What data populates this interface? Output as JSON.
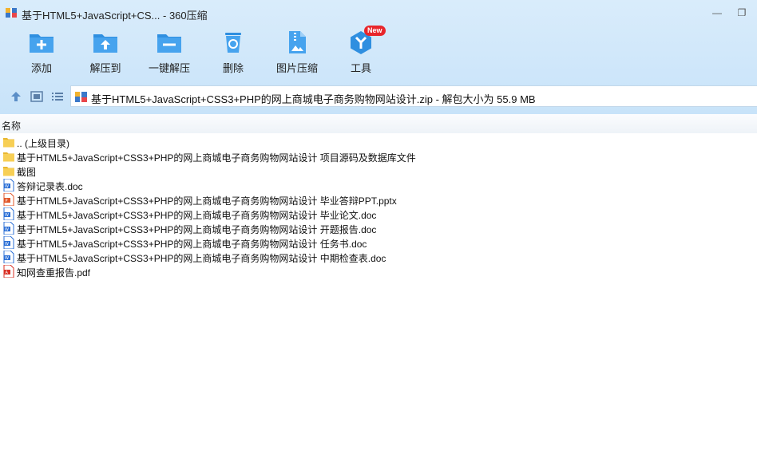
{
  "window": {
    "title": "基于HTML5+JavaScript+CS... - 360压缩",
    "minimize": "—",
    "maximize": "❐"
  },
  "toolbar": [
    {
      "label": "添加",
      "icon": "add-icon"
    },
    {
      "label": "解压到",
      "icon": "extract-to-icon"
    },
    {
      "label": "一键解压",
      "icon": "one-click-extract-icon"
    },
    {
      "label": "删除",
      "icon": "delete-icon"
    },
    {
      "label": "图片压缩",
      "icon": "image-compress-icon"
    },
    {
      "label": "工具",
      "icon": "tools-icon",
      "badge": "New"
    }
  ],
  "address": {
    "path": "基于HTML5+JavaScript+CSS3+PHP的网上商城电子商务购物网站设计.zip - 解包大小为 55.9 MB"
  },
  "columns": {
    "name": "名称"
  },
  "files": [
    {
      "name": ".. (上级目录)",
      "type": "folder"
    },
    {
      "name": "基于HTML5+JavaScript+CSS3+PHP的网上商城电子商务购物网站设计 项目源码及数据库文件",
      "type": "folder"
    },
    {
      "name": "截图",
      "type": "folder"
    },
    {
      "name": "答辩记录表.doc",
      "type": "doc"
    },
    {
      "name": "基于HTML5+JavaScript+CSS3+PHP的网上商城电子商务购物网站设计 毕业答辩PPT.pptx",
      "type": "ppt"
    },
    {
      "name": "基于HTML5+JavaScript+CSS3+PHP的网上商城电子商务购物网站设计 毕业论文.doc",
      "type": "doc"
    },
    {
      "name": "基于HTML5+JavaScript+CSS3+PHP的网上商城电子商务购物网站设计 开题报告.doc",
      "type": "doc"
    },
    {
      "name": "基于HTML5+JavaScript+CSS3+PHP的网上商城电子商务购物网站设计 任务书.doc",
      "type": "doc"
    },
    {
      "name": "基于HTML5+JavaScript+CSS3+PHP的网上商城电子商务购物网站设计 中期检查表.doc",
      "type": "doc"
    },
    {
      "name": "知网查重报告.pdf",
      "type": "pdf"
    }
  ],
  "colors": {
    "accent": "#2f8fe0",
    "folder": "#f5c542",
    "doc": "#2b6fd6",
    "ppt": "#e0562a",
    "pdf": "#d93025"
  }
}
